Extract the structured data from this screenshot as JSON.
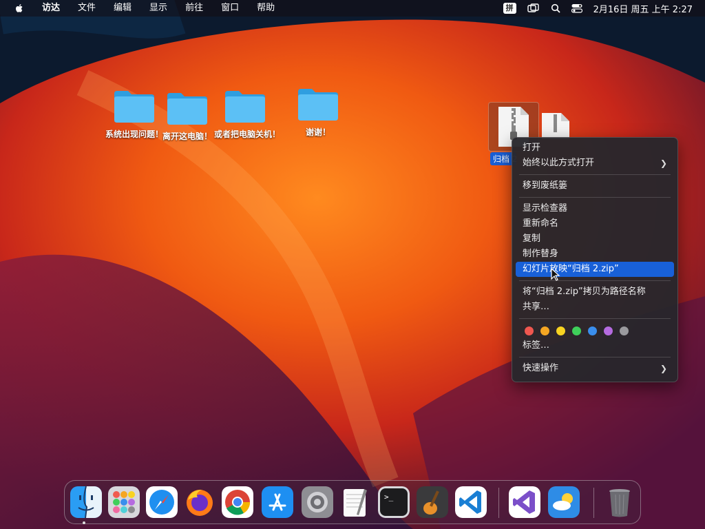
{
  "menubar": {
    "apple_icon": "apple-logo-icon",
    "app_name": "访达",
    "items": [
      "文件",
      "编辑",
      "显示",
      "前往",
      "窗口",
      "帮助"
    ],
    "input_method": "拼",
    "clock": "2月16日 周五 上午 2:27"
  },
  "desktop": {
    "folders": [
      {
        "label": "系统出现问题！"
      },
      {
        "label": "离开这电脑！"
      },
      {
        "label": "或者把电脑关机！"
      },
      {
        "label": "谢谢！"
      }
    ],
    "selected_file_label": "归档 2.zip"
  },
  "context_menu": {
    "open": "打开",
    "open_with": "始终以此方式打开",
    "move_to_trash": "移到废纸篓",
    "show_inspector": "显示检查器",
    "rename": "重新命名",
    "duplicate": "复制",
    "make_alias": "制作替身",
    "slideshow": "幻灯片放映“归档 2.zip”",
    "copy_path": "将“归档 2.zip”拷贝为路径名称",
    "share": "共享…",
    "tags_label": "标签…",
    "quick_actions": "快速操作",
    "tag_colors": [
      "#f0574f",
      "#f5a623",
      "#f8d321",
      "#3fcf5a",
      "#3a8eed",
      "#b56be0",
      "#9a9a9e"
    ]
  },
  "dock": {
    "apps": [
      "finder-icon",
      "launchpad-icon",
      "safari-icon",
      "firefox-icon",
      "chrome-icon",
      "app-store-icon",
      "system-settings-icon",
      "textedit-icon",
      "terminal-icon",
      "garageband-icon",
      "vscode-icon",
      "visual-studio-icon",
      "weather-icon",
      "trash-icon"
    ]
  }
}
